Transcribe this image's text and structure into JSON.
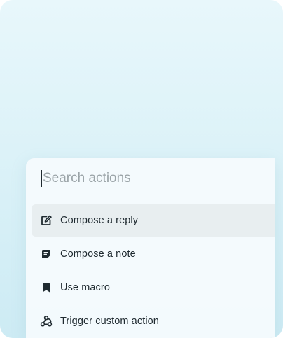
{
  "search": {
    "placeholder": "Search actions",
    "value": ""
  },
  "actions": [
    {
      "label": "Compose a reply",
      "icon": "compose-reply-icon",
      "active": true
    },
    {
      "label": "Compose a note",
      "icon": "note-icon",
      "active": false
    },
    {
      "label": "Use macro",
      "icon": "bookmark-icon",
      "active": false
    },
    {
      "label": "Trigger custom action",
      "icon": "webhook-icon",
      "active": false
    }
  ],
  "colors": {
    "background_top": "#e8f7fb",
    "background_bottom": "#cdebf4",
    "active_row": "#e8eef0",
    "text": "#1f2a30",
    "placeholder": "#9aa3a7"
  }
}
